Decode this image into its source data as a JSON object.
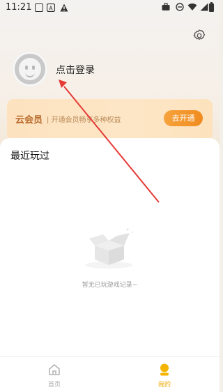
{
  "status_bar": {
    "time": "11:21",
    "icons_left": [
      "picture-icon",
      "font-a-icon",
      "warning-icon"
    ],
    "icons_right": [
      "briefcase-icon",
      "do-not-disturb-icon",
      "wifi-icon",
      "signal-icon",
      "battery-icon"
    ]
  },
  "header": {
    "settings_icon": "gear-icon",
    "login_text": "点击登录"
  },
  "vip": {
    "title": "云会员",
    "subtitle": "| 开通会员畅享多种权益",
    "button_label": "去开通"
  },
  "recent": {
    "title": "最近玩过",
    "empty_text": "暂无已玩游戏记录~"
  },
  "bottom_nav": {
    "items": [
      {
        "label": "首页",
        "icon": "home-icon",
        "active": false
      },
      {
        "label": "我的",
        "icon": "profile-icon",
        "active": true
      }
    ]
  },
  "colors": {
    "accent": "#f5b400",
    "vip_text": "#b96b2c",
    "annotation_arrow": "#e53935"
  }
}
